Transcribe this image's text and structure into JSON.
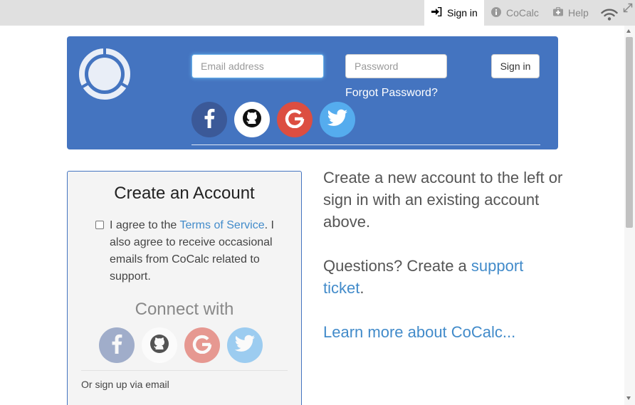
{
  "topbar": {
    "signin_label": "Sign in",
    "cocalc_label": "CoCalc",
    "help_label": "Help"
  },
  "header": {
    "email_placeholder": "Email address",
    "password_placeholder": "Password",
    "signin_button": "Sign in",
    "forgot_password": "Forgot Password?",
    "social": [
      "facebook-icon",
      "github-icon",
      "google-icon",
      "twitter-icon"
    ]
  },
  "create": {
    "title": "Create an Account",
    "agree_prefix": "I agree to the ",
    "terms_link": "Terms of Service",
    "agree_suffix": ". I also agree to receive occasional emails from CoCalc related to support.",
    "connect_with": "Connect with",
    "or_email": "Or sign up via email"
  },
  "info": {
    "line1": "Create a new account to the left or sign in with an existing account above.",
    "questions_prefix": "Questions? Create a ",
    "support_link": "support ticket",
    "questions_suffix": ".",
    "learn_more": "Learn more about CoCalc..."
  },
  "colors": {
    "panel": "#4474c0",
    "facebook": "#3b5998",
    "github": "#ffffff",
    "google": "#dc4e41",
    "twitter": "#55acee",
    "link": "#428bca"
  }
}
